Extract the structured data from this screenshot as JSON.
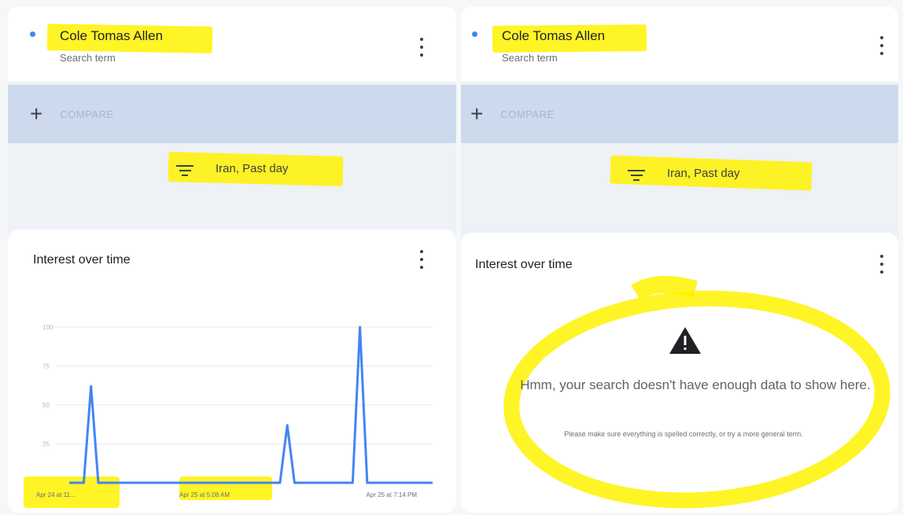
{
  "left_panel": {
    "term": {
      "title": "Cole Tomas Allen",
      "subtitle": "Search term"
    },
    "compare_label": "COMPARE",
    "filter_label": "Iran, Past day",
    "card_title": "Interest over time"
  },
  "right_panel": {
    "term": {
      "title": "Cole Tomas Allen",
      "subtitle": "Search term"
    },
    "compare_label": "COMPARE",
    "filter_label": "Iran, Past day",
    "card_title": "Interest over time",
    "message": {
      "main": "Hmm, your search doesn't have enough data to show here.",
      "sub": "Please make sure everything is spelled correctly, or try a more general term."
    }
  },
  "colors": {
    "line": "#4285f4",
    "highlight": "#fff200",
    "compare_bar": "#cdd9ec"
  },
  "chart_data": {
    "type": "line",
    "ylim": [
      0,
      100
    ],
    "y_ticks": [
      "100",
      "75",
      "50",
      "25"
    ],
    "x_tick_labels": [
      "Apr 24 at 11...",
      "Apr 25 at 5:08 AM",
      "Apr 25 at 7:14 PM"
    ],
    "series": [
      {
        "x": [
          0,
          0.02,
          0.04,
          0.06,
          0.08,
          0.56,
          0.58,
          0.6,
          0.62,
          0.76,
          0.78,
          0.8,
          0.82,
          1.0
        ],
        "values": [
          0,
          0,
          0,
          62,
          0,
          0,
          0,
          37,
          0,
          0,
          0,
          100,
          0,
          0
        ]
      }
    ]
  }
}
